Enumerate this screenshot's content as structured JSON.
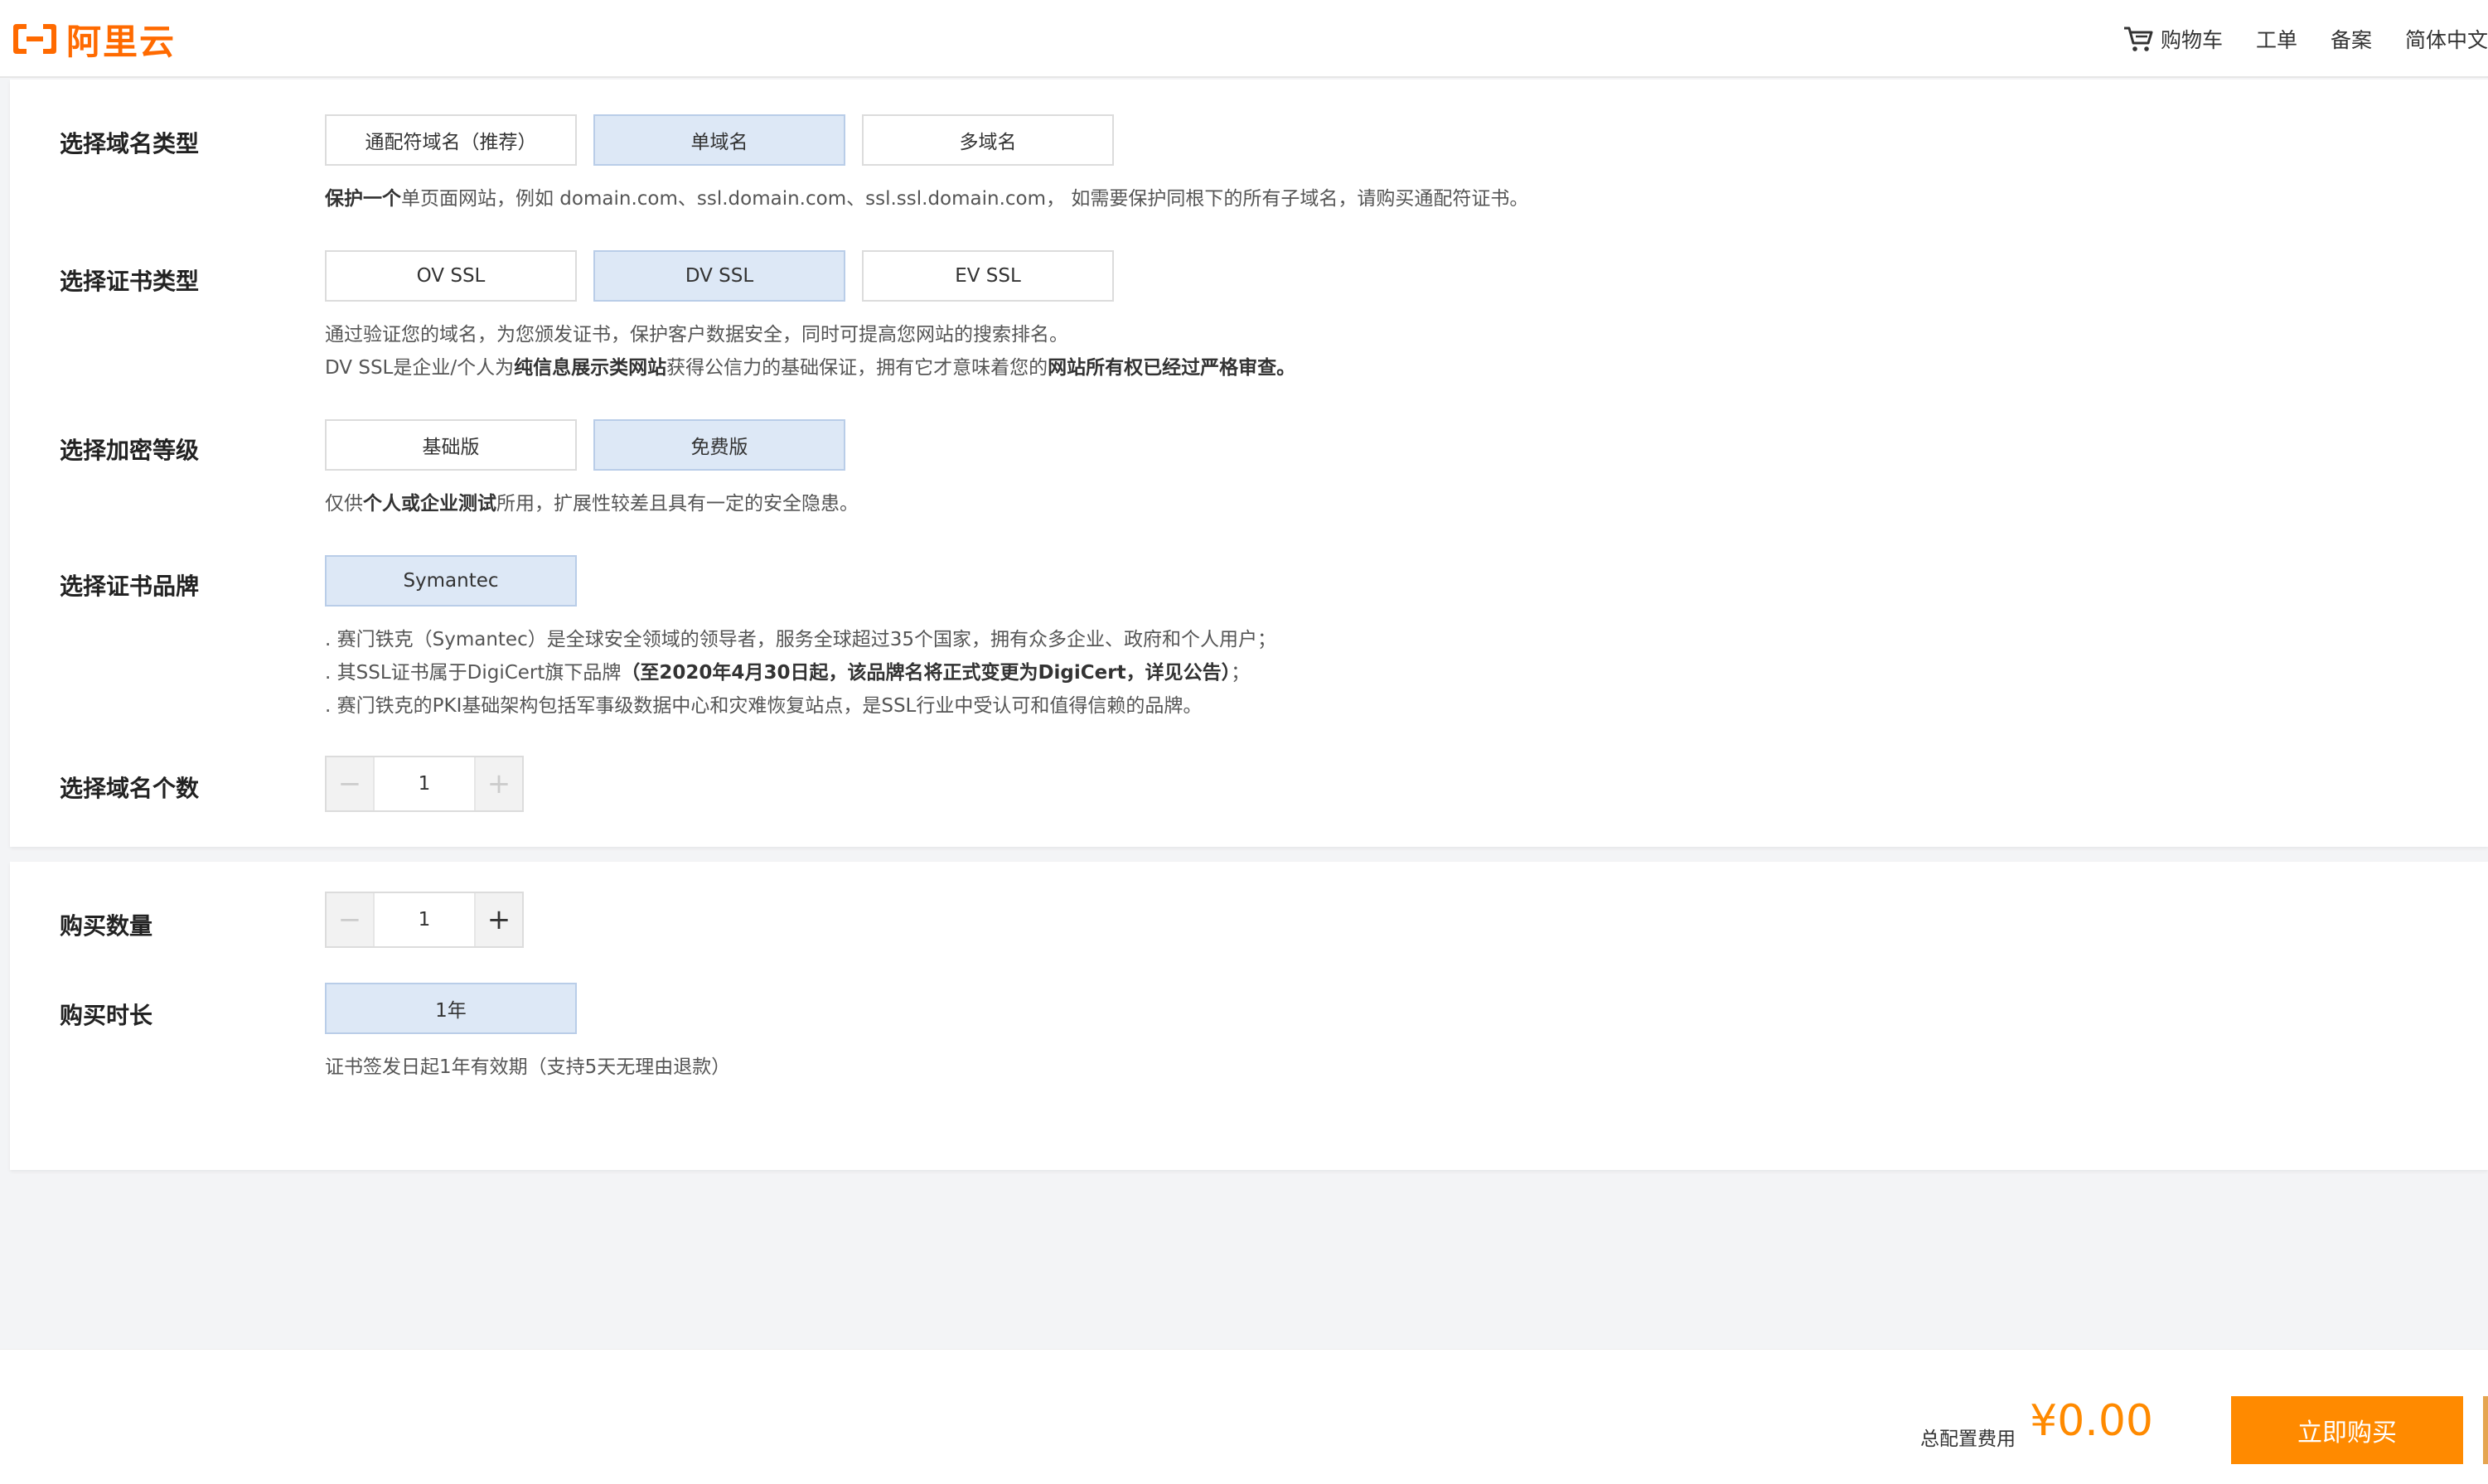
{
  "header": {
    "logo_text": "阿里云",
    "nav": {
      "cart": "购物车",
      "ticket": "工单",
      "filing": "备案",
      "language": "简体中文"
    }
  },
  "domain_type": {
    "label": "选择域名类型",
    "options": [
      "通配符域名（推荐）",
      "单域名",
      "多域名"
    ],
    "selected": "单域名",
    "desc_bold": "保护一个",
    "desc_rest": "单页面网站，例如 domain.com、ssl.domain.com、ssl.ssl.domain.com， 如需要保护同根下的所有子域名，请购买通配符证书。"
  },
  "cert_type": {
    "label": "选择证书类型",
    "options": [
      "OV SSL",
      "DV SSL",
      "EV SSL"
    ],
    "selected": "DV SSL",
    "desc_line1": "通过验证您的域名，为您颁发证书，保护客户数据安全，同时可提高您网站的搜索排名。",
    "desc_line2_a": "DV SSL是企业/个人为",
    "desc_line2_b": "纯信息展示类网站",
    "desc_line2_c": "获得公信力的基础保证，拥有它才意味着您的",
    "desc_line2_d": "网站所有权已经过严格审查。"
  },
  "encryption": {
    "label": "选择加密等级",
    "options": [
      "基础版",
      "免费版"
    ],
    "selected": "免费版",
    "desc_a": "仅供",
    "desc_b": "个人或企业测试",
    "desc_c": "所用，扩展性较差且具有一定的安全隐患。"
  },
  "brand": {
    "label": "选择证书品牌",
    "options": [
      "Symantec"
    ],
    "selected": "Symantec",
    "line1": ". 赛门铁克（Symantec）是全球安全领域的领导者，服务全球超过35个国家，拥有众多企业、政府和个人用户；",
    "line2_a": ". 其SSL证书属于DigiCert旗下品牌",
    "line2_b": "（至2020年4月30日起，该品牌名将正式变更为DigiCert，详见公告）",
    "line2_c": "；",
    "line3": ". 赛门铁克的PKI基础架构包括军事级数据中心和灾难恢复站点，是SSL行业中受认可和值得信赖的品牌。"
  },
  "domain_count": {
    "label": "选择域名个数",
    "value": "1",
    "minus": "−",
    "plus": "+"
  },
  "quantity": {
    "label": "购买数量",
    "value": "1",
    "minus": "−",
    "plus": "+"
  },
  "duration": {
    "label": "购买时长",
    "options": [
      "1年"
    ],
    "selected": "1年",
    "desc": "证书签发日起1年有效期（支持5天无理由退款）"
  },
  "footer": {
    "total_label": "总配置费用",
    "total_price": "¥0.00",
    "buy_label": "立即购买"
  },
  "colors": {
    "brand": "#ff6a00",
    "price": "#ff8a00",
    "selected_bg": "#dde8f6",
    "buy_button": "#ff8a00"
  }
}
